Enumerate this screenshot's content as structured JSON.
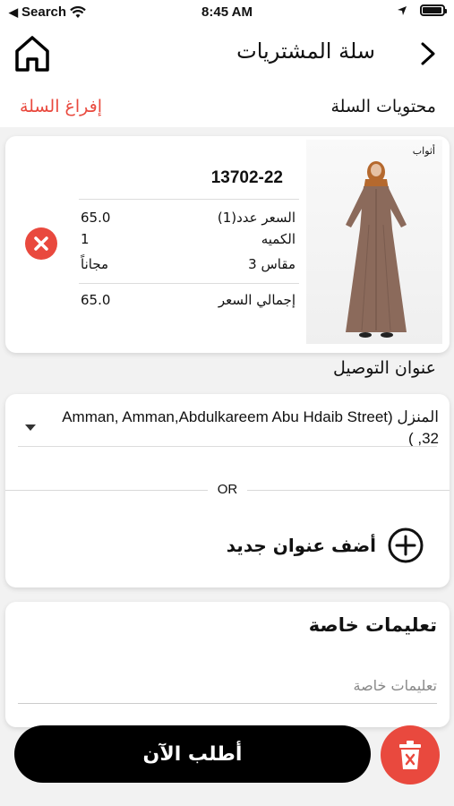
{
  "status_bar": {
    "carrier": "Search",
    "time": "8:45 AM"
  },
  "header": {
    "title": "سلة المشتريات"
  },
  "cart": {
    "section_label": "محتويات السلة",
    "empty_label": "إفراغ السلة"
  },
  "product": {
    "brand": "أثواب",
    "code": "13702-22",
    "price_label": "السعر عدد(1)",
    "price_value": "65.0",
    "quantity_label": "الكميه",
    "quantity_value": "1",
    "size_label": "مقاس 3",
    "size_value": "مجاناً",
    "total_label": "إجمالي السعر",
    "total_value": "65.0"
  },
  "address": {
    "title": "عنوان التوصيل",
    "selected": "المنزل (Amman, Amman,Abdulkareem Abu Hdaib Street 32, )",
    "or_text": "OR",
    "add_label": "أضف عنوان جديد"
  },
  "notes": {
    "title": "تعليمات خاصة",
    "placeholder": "تعليمات خاصة"
  },
  "actions": {
    "order_label": "أطلب الآن"
  },
  "colors": {
    "accent": "#e9493e",
    "primary_button": "#000000",
    "dress": "#8b6a5b",
    "hijab": "#b5692e"
  }
}
